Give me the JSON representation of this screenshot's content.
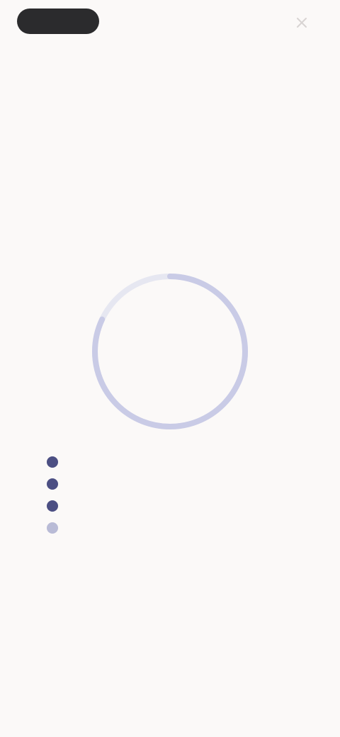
{
  "status_bar": {
    "pill_label": ""
  },
  "header": {
    "close_icon": "close-icon"
  },
  "loading": {
    "subtitle": "",
    "title": "",
    "progress_percent": 82,
    "center_text": "",
    "ring_track_color": "#e6e7f1",
    "ring_fill_color": "#c9cbe6"
  },
  "steps": [
    {
      "label": "",
      "state": "done"
    },
    {
      "label": "",
      "state": "done"
    },
    {
      "label": "",
      "state": "done"
    },
    {
      "label": "",
      "state": "pending"
    }
  ],
  "colors": {
    "background": "#fbf9f8",
    "step_done": "#4c4f83",
    "step_pending": "#b9bbd6"
  }
}
